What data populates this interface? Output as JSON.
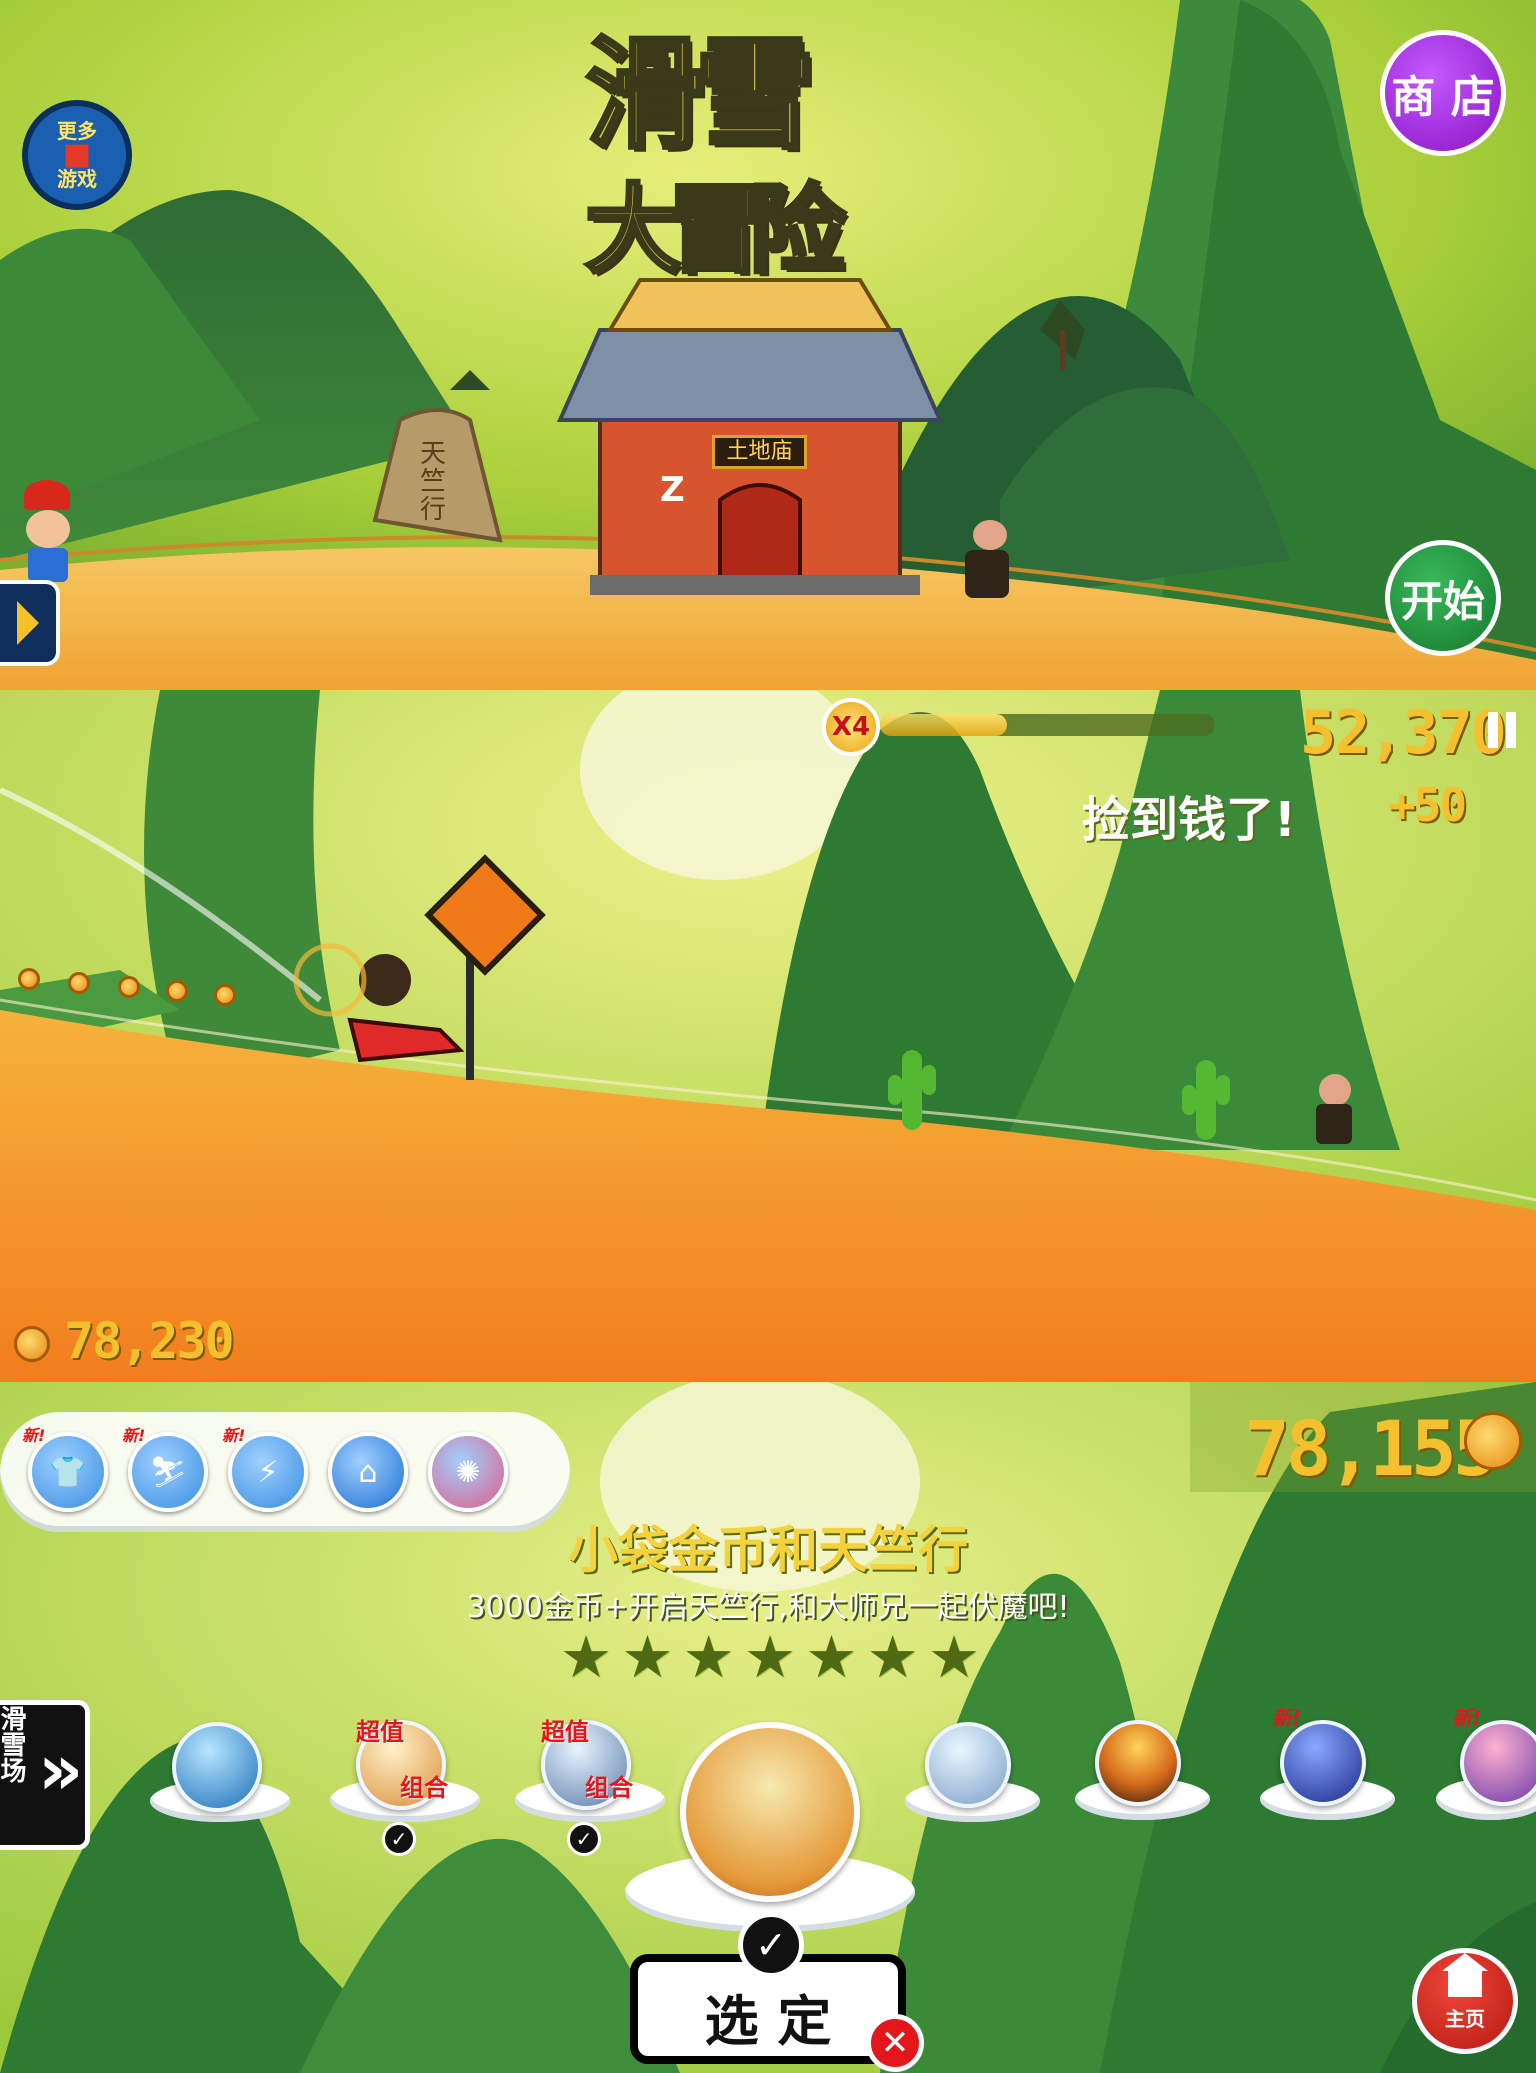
{
  "panel_menu": {
    "title_line1": "滑雪",
    "title_line2": "大冒险",
    "more_games": {
      "line1": "更多",
      "line2": "游戏",
      "icon": "gift-icon"
    },
    "shop_label": "商 店",
    "start_label": "开始",
    "side_tab_icon": "play-arrow-icon",
    "temple_sign": "土地庙",
    "stone_sign": "天竺行",
    "sleep_glyph": "Z"
  },
  "panel_run": {
    "multiplier": "X4",
    "multiplier_progress": 0.38,
    "score": "52,370",
    "pause_icon": "pause-icon",
    "event_text": "捡到钱了!",
    "event_bonus": "+50",
    "coins_total": "78,230"
  },
  "panel_select": {
    "coins_total": "78,155",
    "category_icons": [
      "shirt-icon",
      "snowmobile-icon",
      "lightning-icon",
      "house-tool-icon",
      "coin-pack-icon"
    ],
    "category_new_tag": "新!",
    "item_title": "小袋金币和天竺行",
    "item_desc": "3000金币+开启天竺行,和大师兄一起伏魔吧!",
    "star_count": 7,
    "stage_left_label": "滑雪场",
    "deal_badge": {
      "top": "超值",
      "bottom": "组合"
    },
    "confirm_label": "选 定",
    "home_label": "主页",
    "colors": {
      "accent_gold": "#f4c02d",
      "shop_purple": "#9b1fd0",
      "start_green": "#1f8a3c",
      "home_red": "#d92a1c"
    }
  }
}
